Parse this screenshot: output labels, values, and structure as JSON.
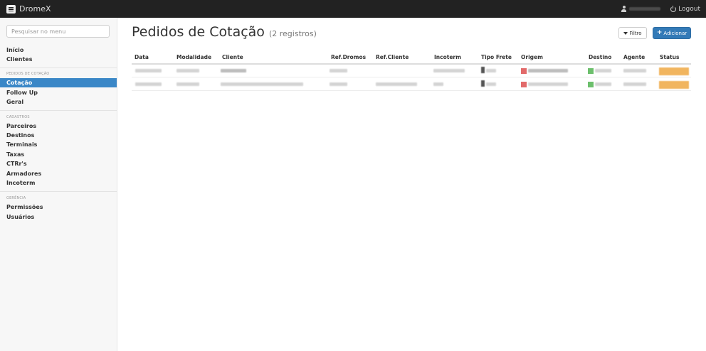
{
  "app": {
    "brand": "DromeX",
    "logout_label": "Logout"
  },
  "sidebar": {
    "search_placeholder": "Pesquisar no menu",
    "items_top": [
      "Início",
      "Clientes"
    ],
    "section_pedidos": "PEDIDOS DE COTAÇÃO",
    "items_pedidos": [
      "Cotação",
      "Follow Up",
      "Geral"
    ],
    "active_item": "Cotação",
    "section_cadastros": "CADASTROS",
    "items_cadastros": [
      "Parceiros",
      "Destinos",
      "Terminais",
      "Taxas",
      "CTRr's",
      "Armadores",
      "Incoterm"
    ],
    "section_gerencia": "GERÊNCIA",
    "items_gerencia": [
      "Permissões",
      "Usuários"
    ]
  },
  "main": {
    "title": "Pedidos de Cotação",
    "count": "(2 registros)",
    "filter_label": "Filtro",
    "add_label": "Adicionar"
  },
  "table": {
    "columns": [
      "Data",
      "Modalidade",
      "Cliente",
      "Ref.Dromos",
      "Ref.Cliente",
      "Incoterm",
      "Tipo Frete",
      "Origem",
      "Destino",
      "Agente",
      "Status"
    ]
  },
  "colors": {
    "navbar": "#222222",
    "active": "#3a87c7",
    "primary_button": "#337ab7",
    "status": "#f0ad4e",
    "origin_flag": "#e26a6a",
    "destination_flag": "#6cbf6c"
  }
}
